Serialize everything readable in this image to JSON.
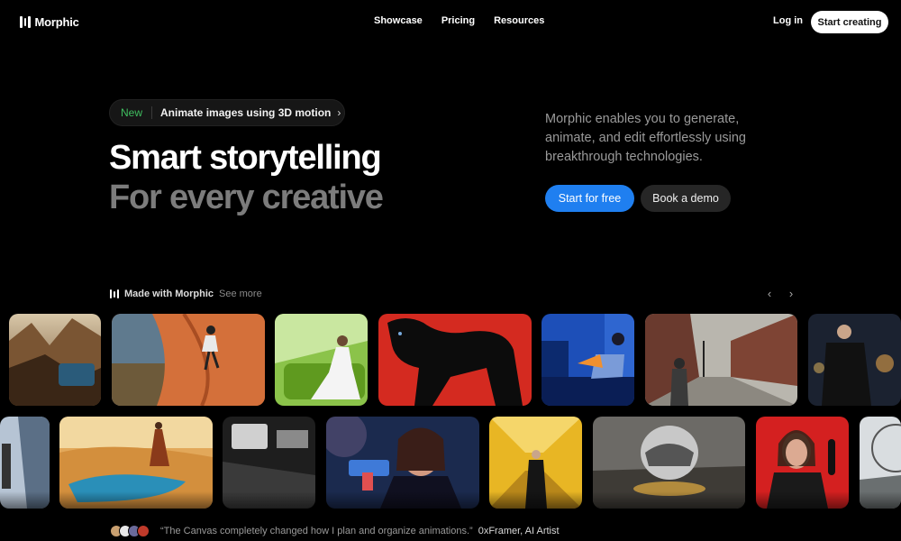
{
  "nav": {
    "brand": "Morphic",
    "links": [
      "Showcase",
      "Pricing",
      "Resources"
    ],
    "login": "Log in",
    "cta": "Start creating"
  },
  "hero": {
    "badge": "New",
    "announcement": "Animate images using 3D motion",
    "headline_line1": "Smart storytelling",
    "headline_line2": "For every creative",
    "tagline": "Morphic enables you to generate, animate, and edit effortlessly using breakthrough technologies.",
    "primary_button": "Start for free",
    "secondary_button": "Book a demo"
  },
  "showcase": {
    "title": "Made with Morphic",
    "see_more": "See more",
    "prev_icon": "chevron-left-icon",
    "next_icon": "chevron-right-icon"
  },
  "testimonial": {
    "quote": "“The Canvas completely changed how I plan and organize animations.”",
    "author": "0xFramer, AI Artist"
  },
  "colors": {
    "background": "#000000",
    "accent": "#1f7ff0",
    "new_badge": "#3fbf5f",
    "muted_headline": "#7c7c7c"
  }
}
